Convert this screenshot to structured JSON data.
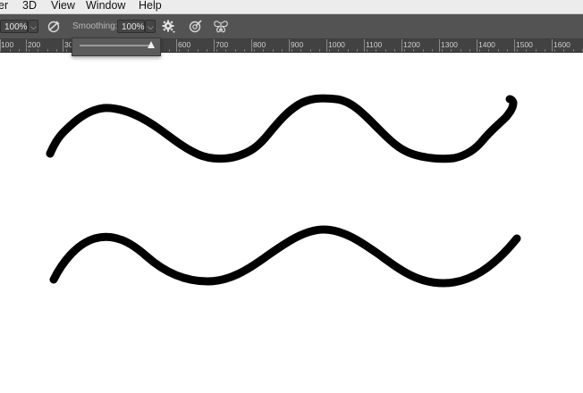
{
  "menubar": {
    "items": [
      "er",
      "3D",
      "View",
      "Window",
      "Help"
    ]
  },
  "options": {
    "size_value": "100%",
    "smoothing_label": "Smoothing:",
    "smoothing_value": "100%",
    "slider_fraction": 1.0
  },
  "ruler": {
    "labels": [
      "100",
      "200",
      "300",
      "600",
      "700",
      "800",
      "900",
      "1000",
      "1100",
      "1200",
      "1300",
      "1400",
      "1500",
      "1600"
    ]
  },
  "icons": {
    "brush_settings": "brush-angle-icon",
    "gear": "gear-icon",
    "pressure": "pressure-icon",
    "symmetry": "symmetry-butterfly-icon"
  },
  "colors": {
    "stroke": "#000000",
    "toolbar": "#535353",
    "ruler": "#424242"
  }
}
